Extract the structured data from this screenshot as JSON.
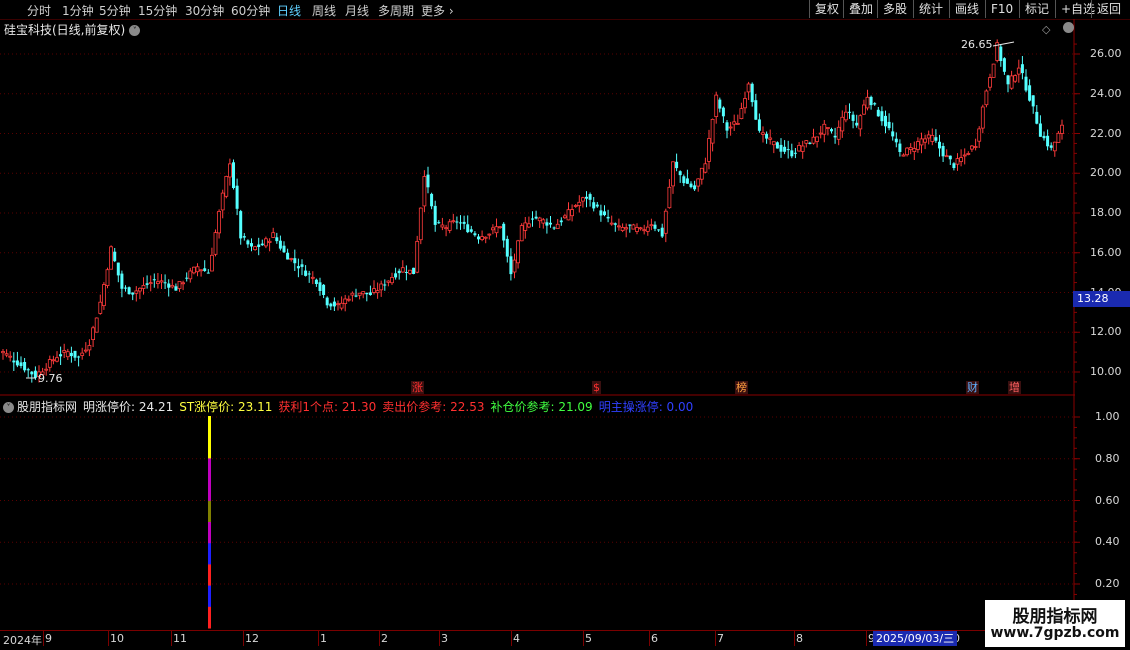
{
  "toolbar": {
    "periods": [
      "分时",
      "1分钟",
      "5分钟",
      "15分钟",
      "30分钟",
      "60分钟",
      "日线",
      "周线",
      "月线",
      "多周期",
      "更多"
    ],
    "active_period": "日线",
    "right_buttons": [
      "复权",
      "叠加",
      "多股",
      "统计",
      "画线",
      "F10",
      "标记",
      "+自选",
      "返回"
    ]
  },
  "stock_title": "硅宝科技(日线,前复权)",
  "price_axis": {
    "labels": [
      "26.00",
      "24.00",
      "22.00",
      "20.00",
      "18.00",
      "16.00",
      "14.00",
      "12.00",
      "10.00"
    ],
    "current_price": "13.28",
    "high_annotation": "26.65",
    "low_annotation": "9.76"
  },
  "chart_markers": [
    {
      "text": "涨",
      "color": "#ff3030"
    },
    {
      "text": "$",
      "color": "#ff3030"
    },
    {
      "text": "榜",
      "color": "#ffa040"
    },
    {
      "text": "财",
      "color": "#5fb0ff"
    },
    {
      "text": "增",
      "color": "#ff6060"
    }
  ],
  "indicator": {
    "name": "股朋指标网",
    "values": [
      {
        "label": "明涨停价: 24.21",
        "color": "#e8e8e8"
      },
      {
        "label": "ST涨停价: 23.11",
        "color": "#ffff40"
      },
      {
        "label": "获利1个点: 21.30",
        "color": "#ff3030"
      },
      {
        "label": "卖出价参考: 22.53",
        "color": "#ff3030"
      },
      {
        "label": "补仓价参考: 21.09",
        "color": "#40ff40"
      },
      {
        "label": "明主操涨停: 0.00",
        "color": "#3040ff"
      }
    ],
    "axis_labels": [
      "1.00",
      "0.80",
      "0.60",
      "0.40",
      "0.20"
    ]
  },
  "time_axis": {
    "labels": [
      "2024年",
      "9",
      "10",
      "11",
      "12",
      "1",
      "2",
      "3",
      "4",
      "5",
      "6",
      "7",
      "8",
      "9",
      "0"
    ],
    "cursor_date": "2025/09/03/三"
  },
  "watermark": {
    "title": "股朋指标网",
    "url": "www.7gpzb.com"
  },
  "chart_data": {
    "type": "candlestick",
    "title": "硅宝科技(日线,前复权)",
    "ylim": [
      9.0,
      27.0
    ],
    "x_range": [
      "2024-08",
      "2025-10"
    ],
    "closing_trend": [
      11.0,
      10.6,
      10.2,
      9.8,
      10.3,
      10.8,
      11.0,
      10.7,
      11.5,
      13.5,
      16.2,
      14.2,
      14.0,
      14.3,
      14.6,
      14.5,
      14.2,
      14.8,
      15.3,
      15.0,
      18.0,
      20.6,
      16.8,
      16.2,
      16.4,
      16.9,
      16.0,
      15.5,
      15.0,
      14.6,
      13.5,
      13.3,
      13.8,
      14.0,
      13.9,
      14.3,
      14.8,
      15.2,
      15.0,
      20.0,
      17.4,
      17.3,
      17.6,
      17.2,
      16.8,
      17.0,
      17.4,
      14.9,
      17.2,
      17.8,
      17.6,
      17.3,
      17.8,
      18.4,
      18.8,
      18.2,
      17.6,
      17.2,
      17.3,
      17.1,
      17.5,
      16.9,
      20.5,
      19.6,
      19.2,
      20.6,
      23.8,
      22.2,
      22.6,
      24.6,
      22.0,
      21.6,
      21.2,
      21.0,
      21.4,
      21.7,
      22.3,
      21.8,
      23.2,
      22.4,
      23.9,
      23.0,
      22.2,
      21.0,
      21.2,
      21.7,
      21.8,
      21.0,
      20.4,
      20.9,
      21.5,
      24.2,
      26.4,
      24.4,
      25.4,
      23.8,
      22.0,
      21.2,
      22.3
    ]
  }
}
